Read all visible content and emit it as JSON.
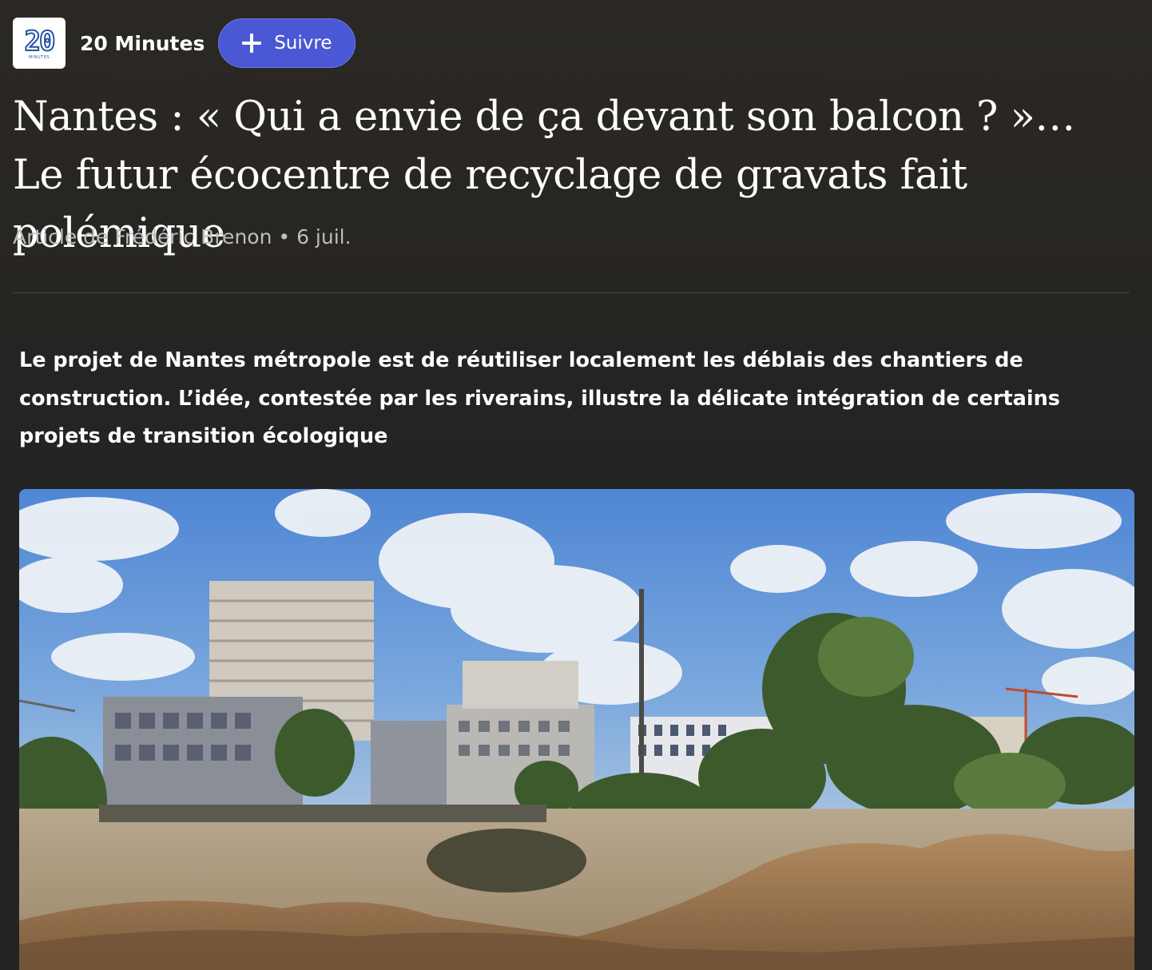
{
  "publisher": {
    "logo_number": "20",
    "logo_subtext": "MINUTES",
    "name": "20 Minutes",
    "follow_label": "Suivre",
    "follow_icon": "plus-icon"
  },
  "article": {
    "title": "Nantes : « Qui a envie de ça devant son balcon ? »… Le futur écocentre de recyclage de gravats fait polémique",
    "byline": "Article de Frédéric Brenon • 6 juil.",
    "lead": "Le projet de Nantes métropole est de réutiliser localement les déblais des chantiers de construction. L’idée, contestée par les riverains, illustre la délicate intégration de certains projets de transition écologique"
  },
  "colors": {
    "background": "#262626",
    "follow_button": "#4a58d6",
    "logo_blue": "#2455a6",
    "byline_gray": "#bdbdbd"
  }
}
